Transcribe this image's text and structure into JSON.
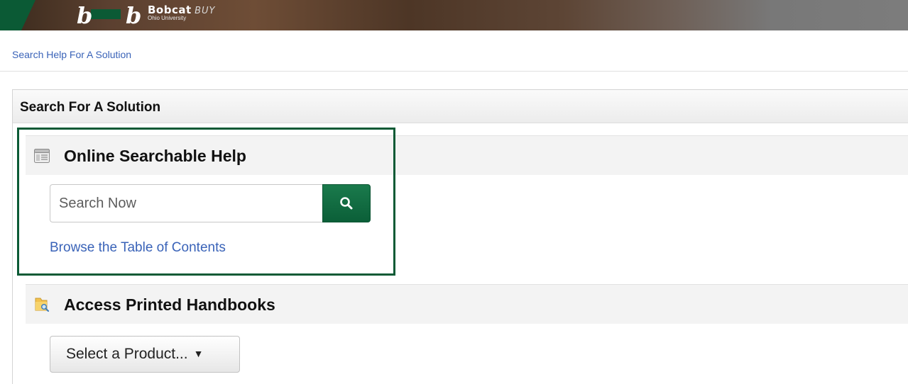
{
  "header": {
    "brand_name": "Bobcat",
    "brand_suffix": "BUY",
    "brand_sub": "Ohio University"
  },
  "breadcrumb": {
    "label": "Search Help For A Solution"
  },
  "panel": {
    "title": "Search For A Solution"
  },
  "online_help": {
    "title": "Online Searchable Help",
    "search_placeholder": "Search Now",
    "browse_label": "Browse the Table of Contents"
  },
  "handbooks": {
    "title": "Access Printed Handbooks",
    "select_label": "Select a Product...",
    "caret": "▼"
  },
  "colors": {
    "brand_green": "#0b5a35",
    "link_blue": "#3a63b8"
  },
  "icons": {
    "online_help": "help-document-icon",
    "search": "search-icon",
    "handbooks": "folder-search-icon",
    "dropdown": "caret-down-icon"
  }
}
